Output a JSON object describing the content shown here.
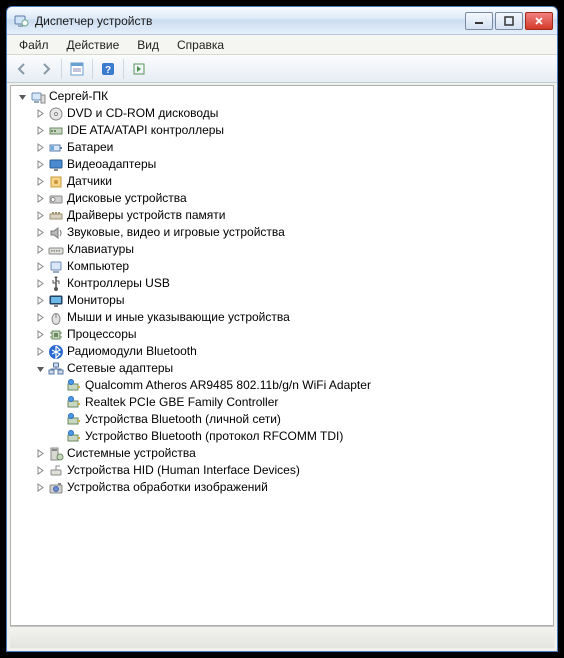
{
  "titlebar": {
    "title": "Диспетчер устройств"
  },
  "menu": {
    "file": "Файл",
    "action": "Действие",
    "view": "Вид",
    "help": "Справка"
  },
  "tree": {
    "root": {
      "label": "Сергей-ПК",
      "expanded": true,
      "icon": "computer"
    },
    "categories": [
      {
        "label": "DVD и CD-ROM дисководы",
        "icon": "disc",
        "expanded": false
      },
      {
        "label": "IDE ATA/ATAPI контроллеры",
        "icon": "ide",
        "expanded": false
      },
      {
        "label": "Батареи",
        "icon": "battery",
        "expanded": false
      },
      {
        "label": "Видеоадаптеры",
        "icon": "display",
        "expanded": false
      },
      {
        "label": "Датчики",
        "icon": "sensor",
        "expanded": false
      },
      {
        "label": "Дисковые устройства",
        "icon": "hdd",
        "expanded": false
      },
      {
        "label": "Драйверы устройств памяти",
        "icon": "memdrv",
        "expanded": false
      },
      {
        "label": "Звуковые, видео и игровые устройства",
        "icon": "audio",
        "expanded": false
      },
      {
        "label": "Клавиатуры",
        "icon": "keyboard",
        "expanded": false
      },
      {
        "label": "Компьютер",
        "icon": "pc",
        "expanded": false
      },
      {
        "label": "Контроллеры USB",
        "icon": "usb",
        "expanded": false
      },
      {
        "label": "Мониторы",
        "icon": "monitor",
        "expanded": false
      },
      {
        "label": "Мыши и иные указывающие устройства",
        "icon": "mouse",
        "expanded": false
      },
      {
        "label": "Процессоры",
        "icon": "cpu",
        "expanded": false
      },
      {
        "label": "Радиомодули Bluetooth",
        "icon": "bluetooth",
        "expanded": false
      },
      {
        "label": "Сетевые адаптеры",
        "icon": "network",
        "expanded": true,
        "children": [
          {
            "label": "Qualcomm Atheros AR9485 802.11b/g/n WiFi Adapter",
            "icon": "netadapter"
          },
          {
            "label": "Realtek PCIe GBE Family Controller",
            "icon": "netadapter"
          },
          {
            "label": "Устройства Bluetooth (личной сети)",
            "icon": "netadapter"
          },
          {
            "label": "Устройство Bluetooth (протокол RFCOMM TDI)",
            "icon": "netadapter"
          }
        ]
      },
      {
        "label": "Системные устройства",
        "icon": "system",
        "expanded": false
      },
      {
        "label": "Устройства HID (Human Interface Devices)",
        "icon": "hid",
        "expanded": false
      },
      {
        "label": "Устройства обработки изображений",
        "icon": "imaging",
        "expanded": false
      }
    ]
  }
}
